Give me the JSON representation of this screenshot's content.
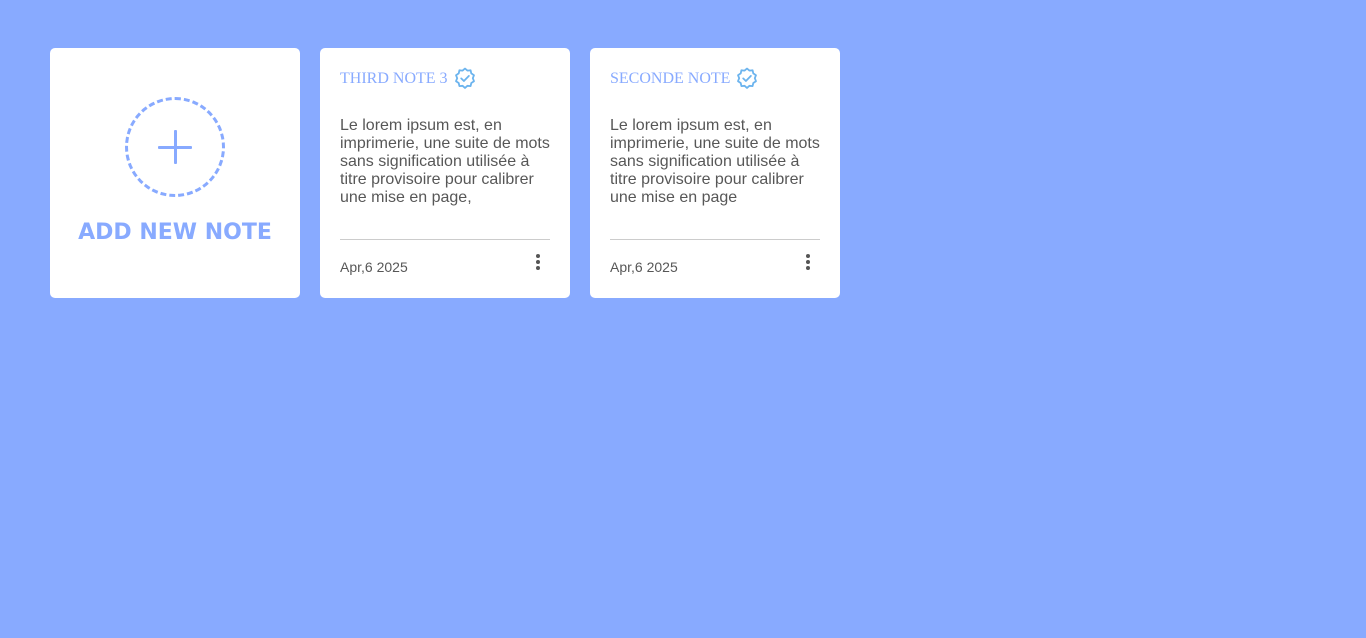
{
  "add_note": {
    "label": "ADD NEW NOTE",
    "icon": "plus-icon"
  },
  "notes": [
    {
      "title": "THIRD NOTE 3",
      "verified_icon": "verified-badge-icon",
      "body": "Le lorem ipsum est, en imprimerie, une suite de mots sans signification utilisée à titre provisoire pour calibrer une mise en page,",
      "date": "Apr,6 2025",
      "menu_icon": "more-vertical-icon"
    },
    {
      "title": "SECONDE NOTE",
      "verified_icon": "verified-badge-icon",
      "body": "Le lorem ipsum est, en imprimerie, une suite de mots sans signification utilisée à titre provisoire pour calibrer une mise en page",
      "date": "Apr,6 2025",
      "menu_icon": "more-vertical-icon"
    }
  ],
  "colors": {
    "background": "#88aaff",
    "card": "#ffffff",
    "accent": "#88aaff",
    "verified_badge": "#6cb4ee",
    "text": "#575757"
  }
}
